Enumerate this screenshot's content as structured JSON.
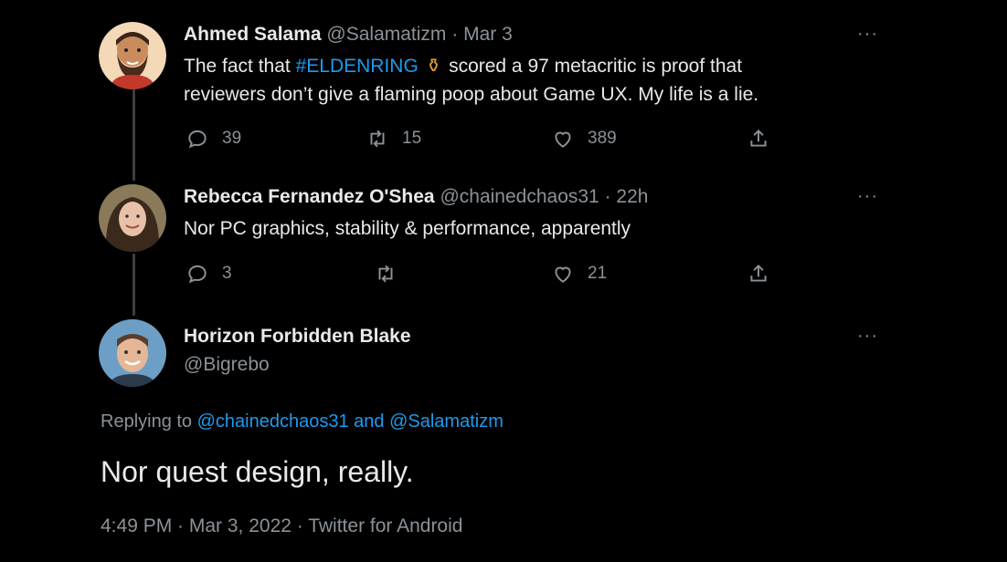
{
  "tweets": [
    {
      "name": "Ahmed Salama",
      "handle": "@Salamatizm",
      "sep": "·",
      "time": "Mar 3",
      "text_before": "The fact that ",
      "hashtag": "#ELDENRING",
      "emoji": "⚱",
      "text_after": " scored a 97 metacritic is proof that",
      "text_line2": "reviewers don’t give a flaming poop about Game UX. My life is a lie.",
      "replies": "39",
      "retweets": "15",
      "likes": "389"
    },
    {
      "name": "Rebecca Fernandez O'Shea",
      "handle": "@chainedchaos31",
      "sep": "·",
      "time": "22h",
      "text": "Nor PC graphics, stability & performance, apparently",
      "replies": "3",
      "retweets": "",
      "likes": "21"
    }
  ],
  "main_tweet": {
    "name": "Horizon Forbidden Blake",
    "handle": "@Bigrebo",
    "replying_prefix": "Replying to ",
    "replying_users": "@chainedchaos31 and @Salamatizm",
    "text": "Nor quest design, really.",
    "timestamp": "4:49 PM · Mar 3, 2022 · Twitter for Android"
  },
  "more_label": "···",
  "colors": {
    "background": "#000000",
    "text": "#e7e9ea",
    "muted": "#8b9298",
    "link": "#1d9bf0"
  },
  "icons": [
    "reply-icon",
    "retweet-icon",
    "like-icon",
    "share-icon",
    "more-icon"
  ]
}
